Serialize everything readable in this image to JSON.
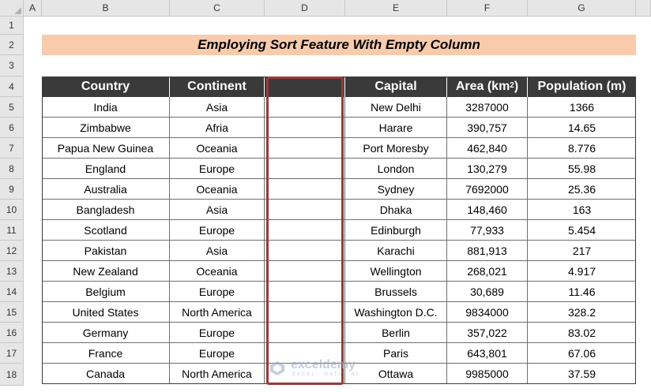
{
  "columns": [
    "A",
    "B",
    "C",
    "D",
    "E",
    "F",
    "G"
  ],
  "rows": [
    "1",
    "2",
    "3",
    "4",
    "5",
    "6",
    "7",
    "8",
    "9",
    "10",
    "11",
    "12",
    "13",
    "14",
    "15",
    "16",
    "17",
    "18"
  ],
  "title": "Employing Sort Feature With Empty Column",
  "headers": {
    "country": "Country",
    "continent": "Continent",
    "empty": "",
    "capital": "Capital",
    "area": "Area (km",
    "area_sup": "2",
    "area_close": ")",
    "population": "Population (m)"
  },
  "data": [
    {
      "country": "India",
      "continent": "Asia",
      "capital": "New Delhi",
      "area": "3287000",
      "population": "1366"
    },
    {
      "country": "Zimbabwe",
      "continent": "Afria",
      "capital": "Harare",
      "area": "390,757",
      "population": "14.65"
    },
    {
      "country": "Papua New Guinea",
      "continent": "Oceania",
      "capital": "Port Moresby",
      "area": "462,840",
      "population": "8.776"
    },
    {
      "country": "England",
      "continent": "Europe",
      "capital": "London",
      "area": "130,279",
      "population": "55.98"
    },
    {
      "country": "Australia",
      "continent": "Oceania",
      "capital": "Sydney",
      "area": "7692000",
      "population": "25.36"
    },
    {
      "country": "Bangladesh",
      "continent": "Asia",
      "capital": "Dhaka",
      "area": "148,460",
      "population": "163"
    },
    {
      "country": "Scotland",
      "continent": "Europe",
      "capital": "Edinburgh",
      "area": "77,933",
      "population": "5.454"
    },
    {
      "country": "Pakistan",
      "continent": "Asia",
      "capital": "Karachi",
      "area": "881,913",
      "population": "217"
    },
    {
      "country": "New Zealand",
      "continent": "Oceania",
      "capital": "Wellington",
      "area": "268,021",
      "population": "4.917"
    },
    {
      "country": "Belgium",
      "continent": "Europe",
      "capital": "Brussels",
      "area": "30,689",
      "population": "11.46"
    },
    {
      "country": "United States",
      "continent": "North America",
      "capital": "Washington D.C.",
      "area": "9834000",
      "population": "328.2"
    },
    {
      "country": "Germany",
      "continent": "Europe",
      "capital": "Berlin",
      "area": "357,022",
      "population": "83.02"
    },
    {
      "country": "France",
      "continent": "Europe",
      "capital": "Paris",
      "area": "643,801",
      "population": "67.06"
    },
    {
      "country": "Canada",
      "continent": "North America",
      "capital": "Ottawa",
      "area": "9985000",
      "population": "37.59"
    }
  ],
  "watermark": {
    "name": "exceldemy",
    "tagline": "EXCEL · DATA · BI"
  },
  "colors": {
    "title_bg": "#f8cbad",
    "header_bg": "#3a3a3a",
    "highlight_border": "#9a3a3a"
  }
}
